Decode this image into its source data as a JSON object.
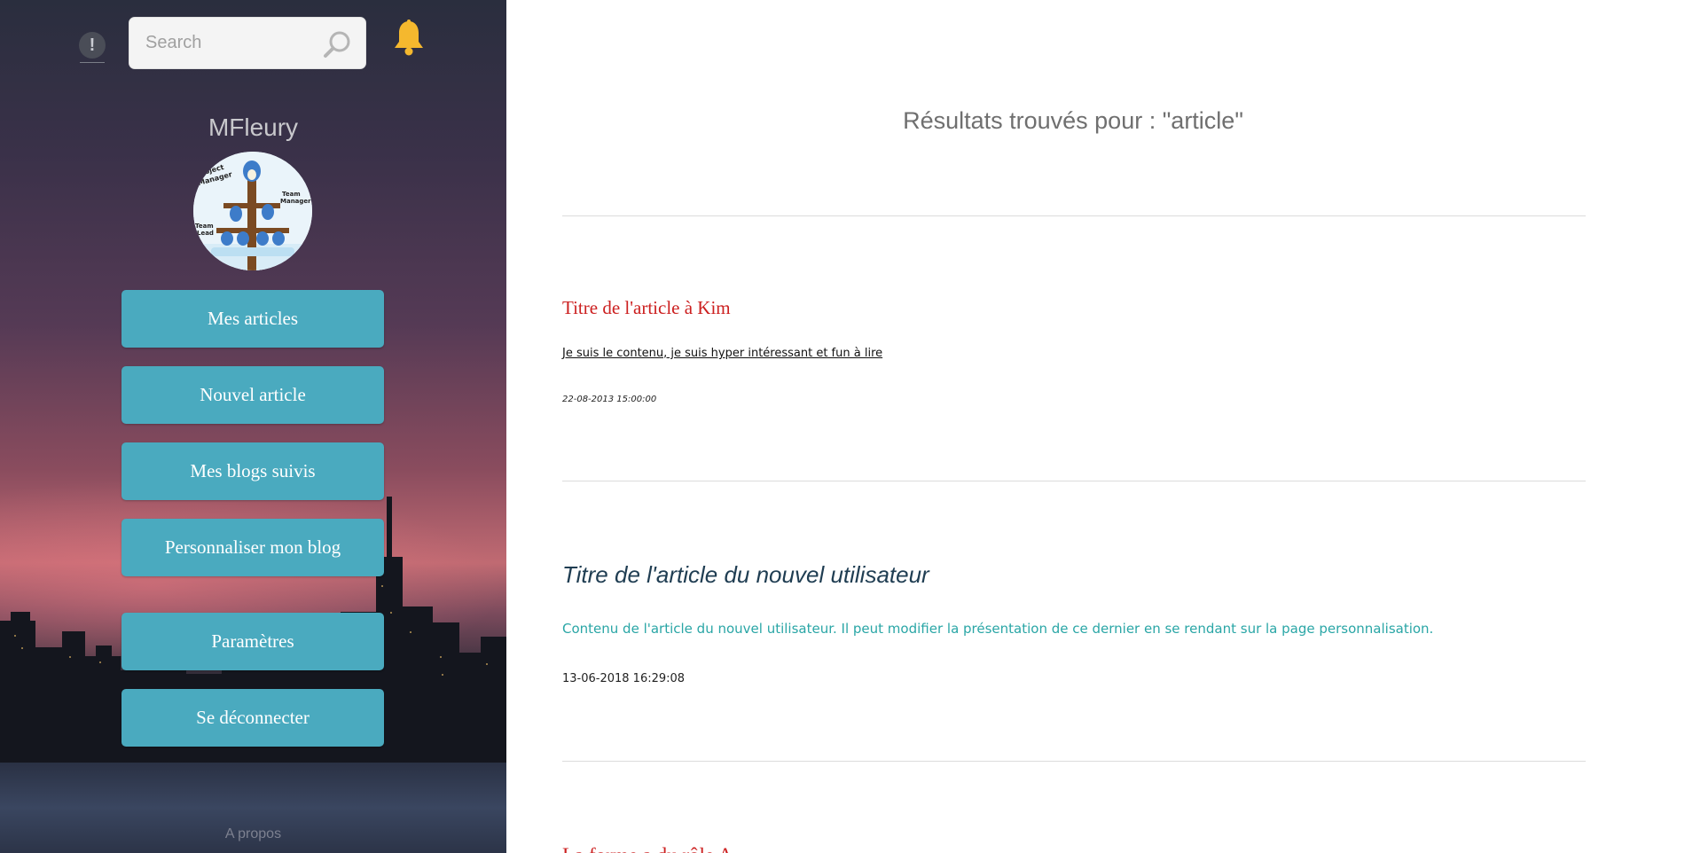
{
  "sidebar": {
    "search": {
      "placeholder": "Search"
    },
    "username": "MFleury",
    "nav": [
      {
        "label": "Mes articles"
      },
      {
        "label": "Nouvel article"
      },
      {
        "label": "Mes blogs suivis"
      },
      {
        "label": "Personnaliser mon blog"
      },
      {
        "label": "Paramètres"
      },
      {
        "label": "Se déconnecter"
      }
    ],
    "alert_icon_glyph": "!",
    "footer_link": "A propos",
    "avatar_labels": [
      "Project Manager",
      "Team Manager",
      "Team Lead"
    ],
    "colors": {
      "button_bg": "#4aaabf",
      "bell": "#f5b82e"
    }
  },
  "main": {
    "heading": "Résultats trouvés pour : \"article\"",
    "articles": [
      {
        "title": "Titre de l'article à Kim",
        "content": "Je suis le contenu, je suis hyper intéressant et fun à lire",
        "date": "22-08-2013 15:00:00",
        "title_color": "#cc2020"
      },
      {
        "title": "Titre de l'article du nouvel utilisateur",
        "content": "Contenu de l'article du nouvel utilisateur. Il peut modifier la présentation de ce dernier en se rendant sur la page personnalisation.",
        "date": "13-06-2018 16:29:08",
        "title_color": "#1f3d52",
        "content_color": "#2aa6a6"
      },
      {
        "title": "La forme a du rôle A",
        "title_color": "#cc2020"
      }
    ]
  }
}
